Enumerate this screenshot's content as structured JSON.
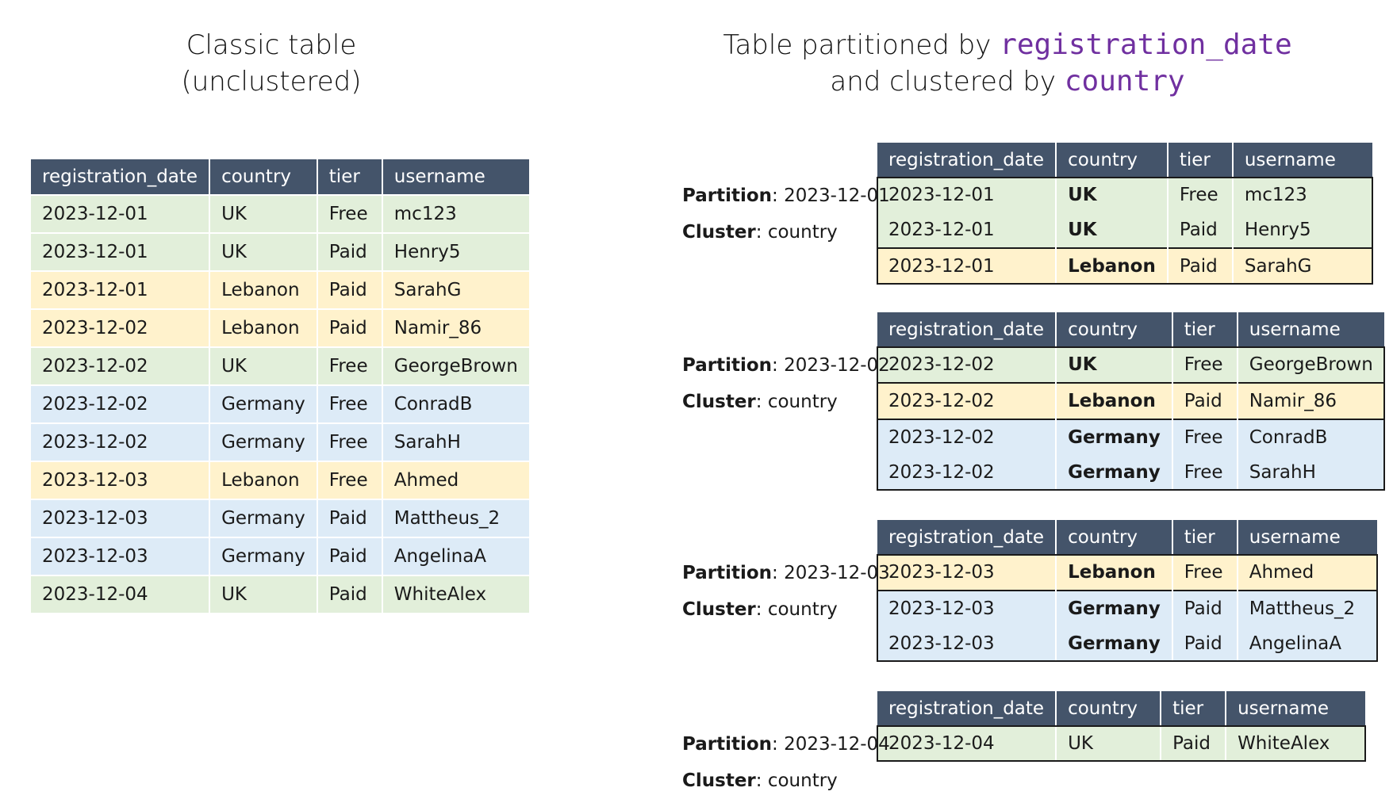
{
  "left_title": {
    "line1": "Classic table",
    "line2": "(unclustered)"
  },
  "right_title": {
    "line1_prefix": "Table partitioned by ",
    "line1_code": "registration_date",
    "line2_prefix": "and clustered by ",
    "line2_code": "country"
  },
  "columns": [
    "registration_date",
    "country",
    "tier",
    "username"
  ],
  "colors": {
    "header": "#44546a",
    "UK": "#e2efda",
    "Lebanon": "#fff2cc",
    "Germany": "#ddebf7",
    "code": "#7030a0"
  },
  "classic_rows": [
    {
      "registration_date": "2023-12-01",
      "country": "UK",
      "tier": "Free",
      "username": "mc123"
    },
    {
      "registration_date": "2023-12-01",
      "country": "UK",
      "tier": "Paid",
      "username": "Henry5"
    },
    {
      "registration_date": "2023-12-01",
      "country": "Lebanon",
      "tier": "Paid",
      "username": "SarahG"
    },
    {
      "registration_date": "2023-12-02",
      "country": "Lebanon",
      "tier": "Paid",
      "username": "Namir_86"
    },
    {
      "registration_date": "2023-12-02",
      "country": "UK",
      "tier": "Free",
      "username": "GeorgeBrown"
    },
    {
      "registration_date": "2023-12-02",
      "country": "Germany",
      "tier": "Free",
      "username": "ConradB"
    },
    {
      "registration_date": "2023-12-02",
      "country": "Germany",
      "tier": "Free",
      "username": "SarahH"
    },
    {
      "registration_date": "2023-12-03",
      "country": "Lebanon",
      "tier": "Free",
      "username": "Ahmed"
    },
    {
      "registration_date": "2023-12-03",
      "country": "Germany",
      "tier": "Paid",
      "username": "Mattheus_2"
    },
    {
      "registration_date": "2023-12-03",
      "country": "Germany",
      "tier": "Paid",
      "username": "AngelinaA"
    },
    {
      "registration_date": "2023-12-04",
      "country": "UK",
      "tier": "Paid",
      "username": "WhiteAlex"
    }
  ],
  "partition_label": "Partition",
  "cluster_label": "Cluster",
  "cluster_value": "country",
  "partitions": [
    {
      "date": "2023-12-01",
      "country_bold": true,
      "rows": [
        {
          "registration_date": "2023-12-01",
          "country": "UK",
          "tier": "Free",
          "username": "mc123"
        },
        {
          "registration_date": "2023-12-01",
          "country": "UK",
          "tier": "Paid",
          "username": "Henry5"
        },
        {
          "registration_date": "2023-12-01",
          "country": "Lebanon",
          "tier": "Paid",
          "username": "SarahG"
        }
      ]
    },
    {
      "date": "2023-12-02",
      "country_bold": true,
      "rows": [
        {
          "registration_date": "2023-12-02",
          "country": "UK",
          "tier": "Free",
          "username": "GeorgeBrown"
        },
        {
          "registration_date": "2023-12-02",
          "country": "Lebanon",
          "tier": "Paid",
          "username": "Namir_86"
        },
        {
          "registration_date": "2023-12-02",
          "country": "Germany",
          "tier": "Free",
          "username": "ConradB"
        },
        {
          "registration_date": "2023-12-02",
          "country": "Germany",
          "tier": "Free",
          "username": "SarahH"
        }
      ]
    },
    {
      "date": "2023-12-03",
      "country_bold": true,
      "rows": [
        {
          "registration_date": "2023-12-03",
          "country": "Lebanon",
          "tier": "Free",
          "username": "Ahmed"
        },
        {
          "registration_date": "2023-12-03",
          "country": "Germany",
          "tier": "Paid",
          "username": "Mattheus_2"
        },
        {
          "registration_date": "2023-12-03",
          "country": "Germany",
          "tier": "Paid",
          "username": "AngelinaA"
        }
      ]
    },
    {
      "date": "2023-12-04",
      "country_bold": false,
      "rows": [
        {
          "registration_date": "2023-12-04",
          "country": "UK",
          "tier": "Paid",
          "username": "WhiteAlex"
        }
      ]
    }
  ]
}
